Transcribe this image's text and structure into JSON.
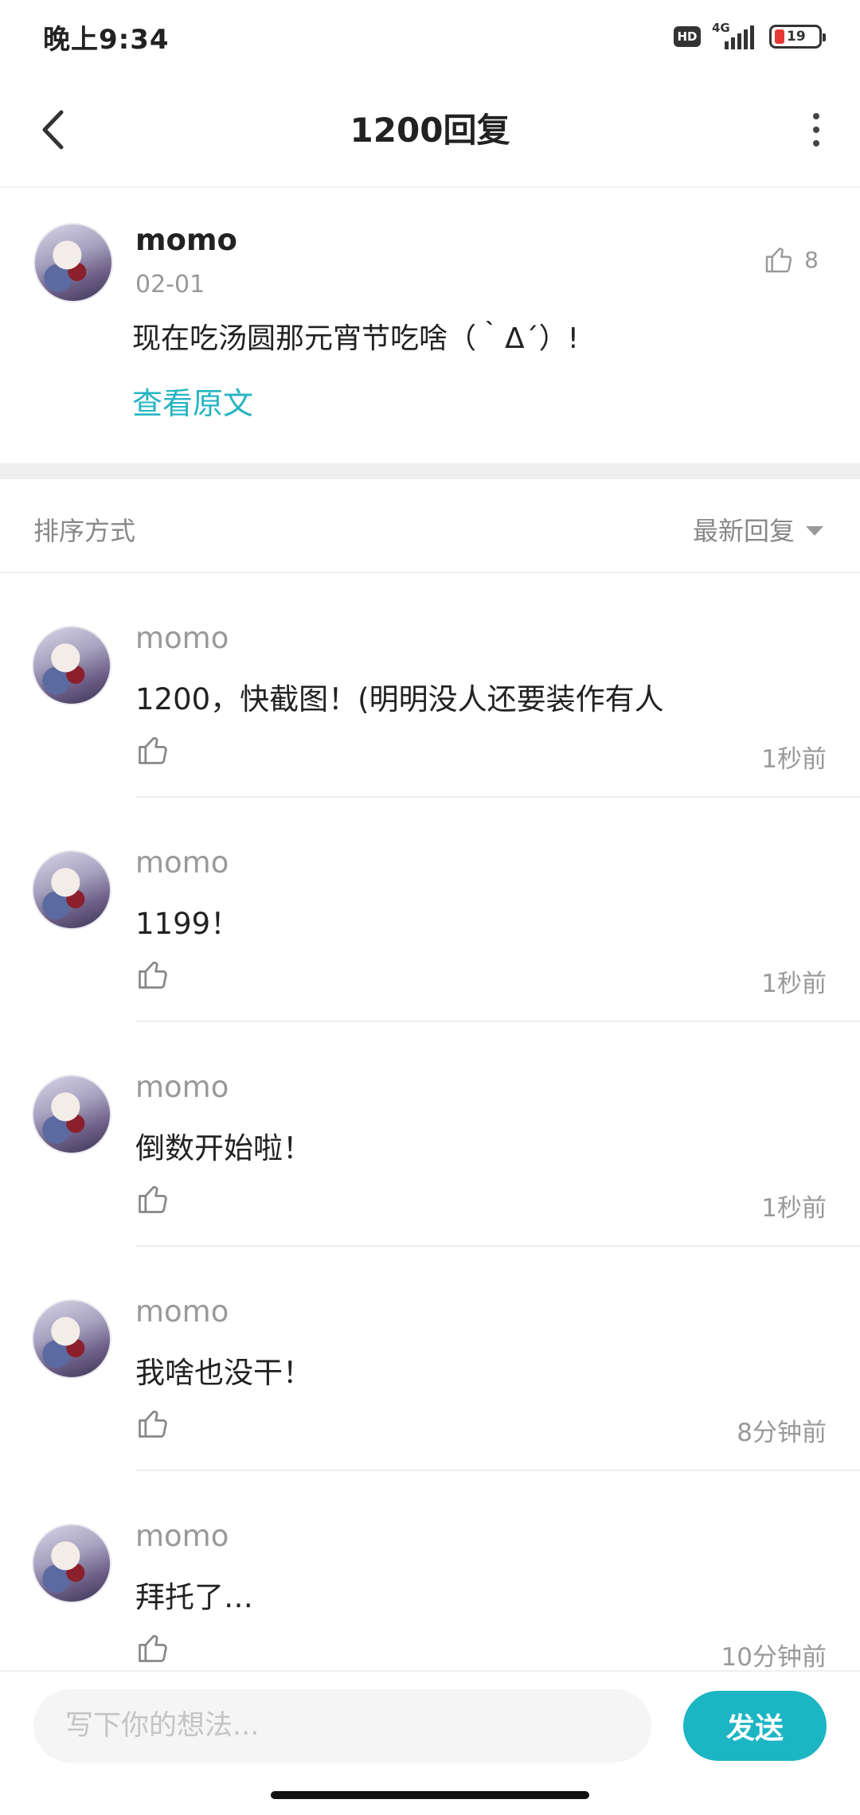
{
  "status_bar": {
    "time": "晚上9:34",
    "hd": "HD",
    "network": "4G",
    "battery": "19"
  },
  "nav": {
    "title": "1200回复"
  },
  "post": {
    "user": "momo",
    "date": "02-01",
    "likes": "8",
    "content": "现在吃汤圆那元宵节吃啥（｀Δ´）!",
    "view_original": "查看原文"
  },
  "sort": {
    "label": "排序方式",
    "value": "最新回复"
  },
  "replies": [
    {
      "user": "momo",
      "text": "1200，快截图！(明明没人还要装作有人",
      "time": "1秒前"
    },
    {
      "user": "momo",
      "text": "1199！",
      "time": "1秒前"
    },
    {
      "user": "momo",
      "text": "倒数开始啦！",
      "time": "1秒前"
    },
    {
      "user": "momo",
      "text": "我啥也没干！",
      "time": "8分钟前"
    },
    {
      "user": "momo",
      "text": "拜托了…",
      "time": "10分钟前"
    }
  ],
  "composer": {
    "placeholder": "写下你的想法...",
    "send_label": "发送"
  },
  "colors": {
    "accent": "#1cb5c4",
    "link": "#26b4c2",
    "battery_low": "#e53935"
  }
}
